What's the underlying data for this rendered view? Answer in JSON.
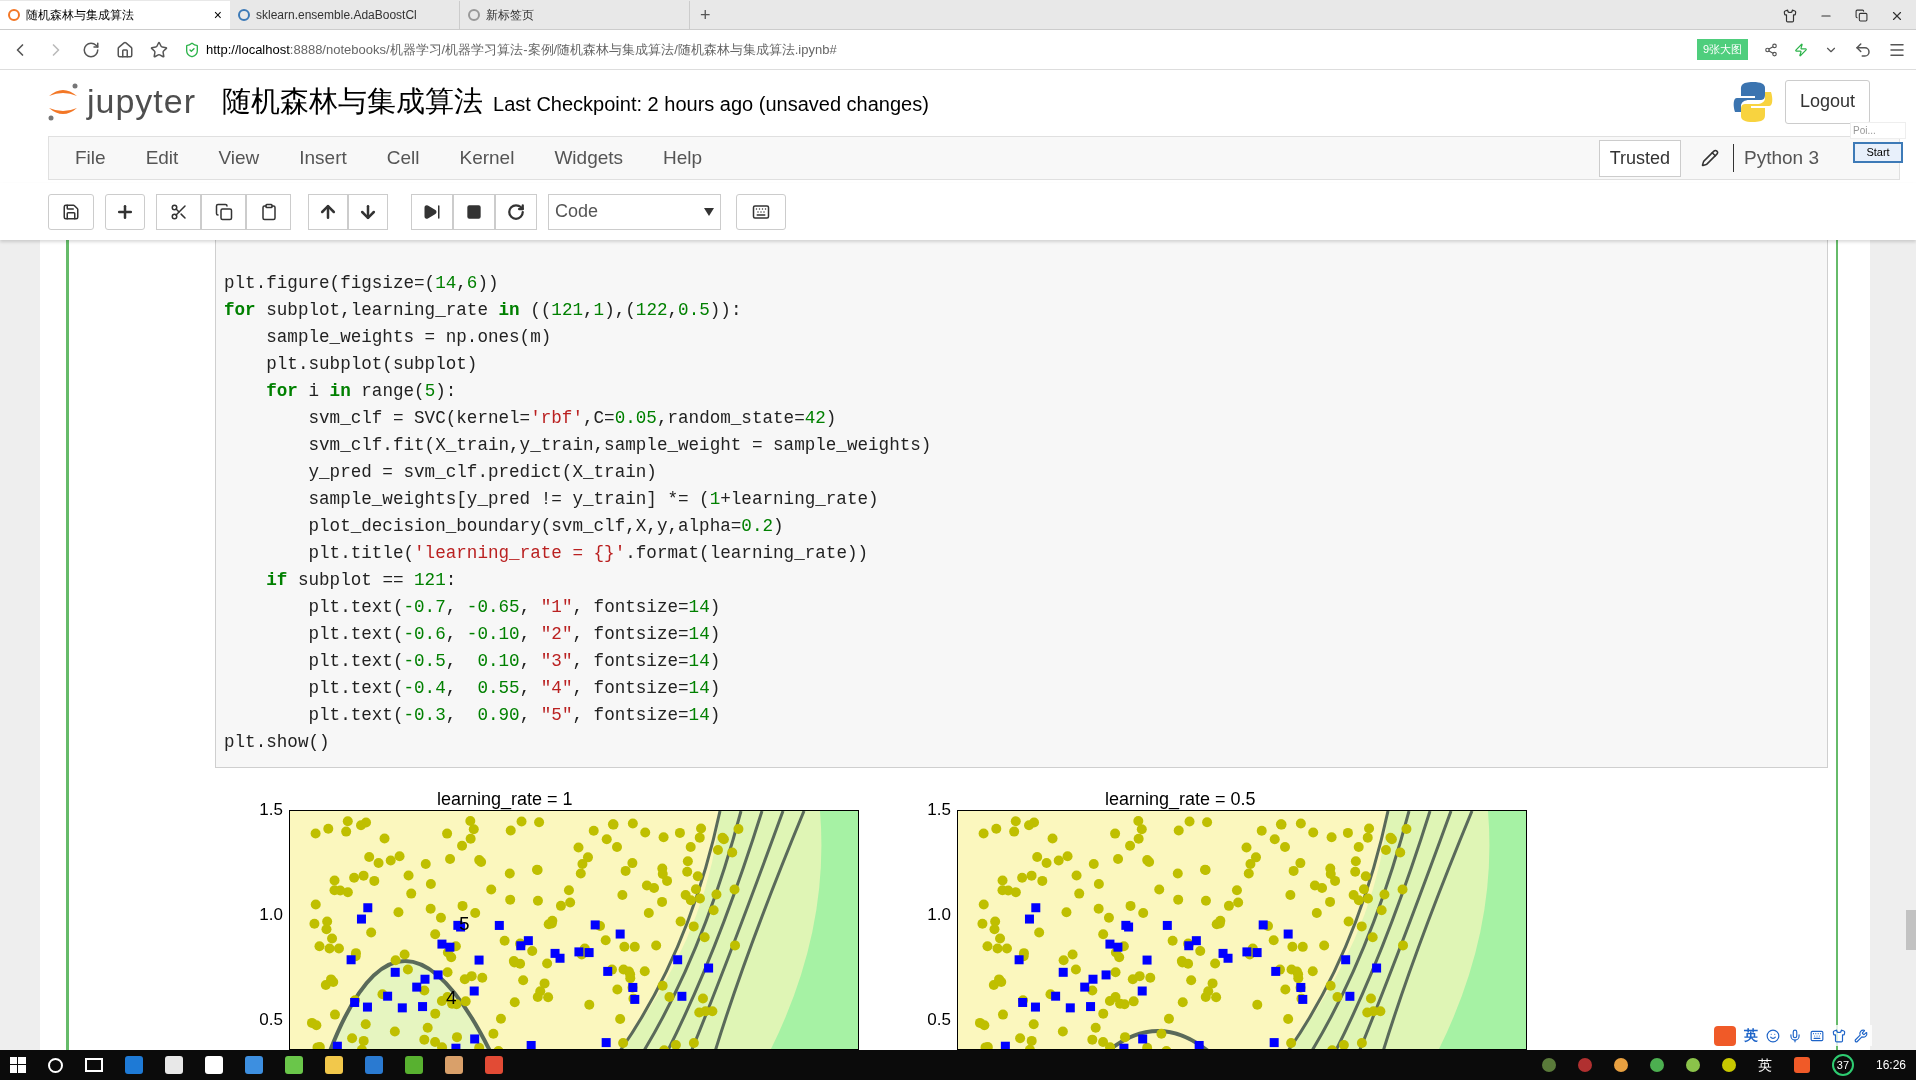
{
  "browser": {
    "tabs": [
      {
        "label": "随机森林与集成算法",
        "selected": true,
        "close": "×"
      },
      {
        "label": "sklearn.ensemble.AdaBoostCl",
        "selected": false
      },
      {
        "label": "新标签页",
        "selected": false
      }
    ],
    "new_tab": "+",
    "url_host": "http://localhost",
    "url_rest": ":8888/notebooks/机器学习/机器学习算法-案例/随机森林与集成算法/随机森林与集成算法.ipynb#",
    "badge": "9张大图"
  },
  "header": {
    "logo_text": "jupyter",
    "title": "随机森林与集成算法",
    "checkpoint": "Last Checkpoint: 2 hours ago (unsaved changes)",
    "logout": "Logout",
    "popup_label": "Poi...",
    "popup_button": "Start"
  },
  "menu": {
    "items": [
      "File",
      "Edit",
      "View",
      "Insert",
      "Cell",
      "Kernel",
      "Widgets",
      "Help"
    ],
    "trusted": "Trusted",
    "kernel": "Python 3"
  },
  "toolbar": {
    "cell_type": "Code"
  },
  "code": [
    [
      {
        "kind": "p",
        "text": "plt.figure(figsize=("
      },
      {
        "kind": "n",
        "text": "14"
      },
      {
        "kind": "p",
        "text": ","
      },
      {
        "kind": "n",
        "text": "6"
      },
      {
        "kind": "p",
        "text": "))"
      }
    ],
    [
      {
        "kind": "k",
        "text": "for"
      },
      {
        "kind": "p",
        "text": " subplot,learning_rate "
      },
      {
        "kind": "k",
        "text": "in"
      },
      {
        "kind": "p",
        "text": " (("
      },
      {
        "kind": "n",
        "text": "121"
      },
      {
        "kind": "p",
        "text": ","
      },
      {
        "kind": "n",
        "text": "1"
      },
      {
        "kind": "p",
        "text": "),("
      },
      {
        "kind": "n",
        "text": "122"
      },
      {
        "kind": "p",
        "text": ","
      },
      {
        "kind": "n",
        "text": "0.5"
      },
      {
        "kind": "p",
        "text": ")):"
      }
    ],
    [
      {
        "kind": "p",
        "text": "    sample_weights = np.ones(m)"
      }
    ],
    [
      {
        "kind": "p",
        "text": "    plt.subplot(subplot)"
      }
    ],
    [
      {
        "kind": "k",
        "text": "    for"
      },
      {
        "kind": "p",
        "text": " i "
      },
      {
        "kind": "k",
        "text": "in"
      },
      {
        "kind": "p",
        "text": " range("
      },
      {
        "kind": "n",
        "text": "5"
      },
      {
        "kind": "p",
        "text": "):"
      }
    ],
    [
      {
        "kind": "p",
        "text": "        svm_clf = SVC(kernel="
      },
      {
        "kind": "s",
        "text": "'rbf'"
      },
      {
        "kind": "p",
        "text": ",C="
      },
      {
        "kind": "n",
        "text": "0.05"
      },
      {
        "kind": "p",
        "text": ",random_state="
      },
      {
        "kind": "n",
        "text": "42"
      },
      {
        "kind": "p",
        "text": ")"
      }
    ],
    [
      {
        "kind": "p",
        "text": "        svm_clf.fit(X_train,y_train,sample_weight = sample_weights)"
      }
    ],
    [
      {
        "kind": "p",
        "text": "        y_pred = svm_clf.predict(X_train)"
      }
    ],
    [
      {
        "kind": "p",
        "text": "        sample_weights[y_pred != y_train] *= ("
      },
      {
        "kind": "n",
        "text": "1"
      },
      {
        "kind": "p",
        "text": "+learning_rate)"
      }
    ],
    [
      {
        "kind": "p",
        "text": "        plot_decision_boundary(svm_clf,X,y,alpha="
      },
      {
        "kind": "n",
        "text": "0.2"
      },
      {
        "kind": "p",
        "text": ")"
      }
    ],
    [
      {
        "kind": "p",
        "text": "        plt.title("
      },
      {
        "kind": "s",
        "text": "'learning_rate = {}'"
      },
      {
        "kind": "p",
        "text": ".format(learning_rate))"
      }
    ],
    [
      {
        "kind": "k",
        "text": "    if"
      },
      {
        "kind": "p",
        "text": " subplot == "
      },
      {
        "kind": "n",
        "text": "121"
      },
      {
        "kind": "p",
        "text": ":"
      }
    ],
    [
      {
        "kind": "p",
        "text": "        plt.text("
      },
      {
        "kind": "n",
        "text": "-0.7"
      },
      {
        "kind": "p",
        "text": ", "
      },
      {
        "kind": "n",
        "text": "-0.65"
      },
      {
        "kind": "p",
        "text": ", "
      },
      {
        "kind": "s",
        "text": "\"1\""
      },
      {
        "kind": "p",
        "text": ", fontsize="
      },
      {
        "kind": "n",
        "text": "14"
      },
      {
        "kind": "p",
        "text": ")"
      }
    ],
    [
      {
        "kind": "p",
        "text": "        plt.text("
      },
      {
        "kind": "n",
        "text": "-0.6"
      },
      {
        "kind": "p",
        "text": ", "
      },
      {
        "kind": "n",
        "text": "-0.10"
      },
      {
        "kind": "p",
        "text": ", "
      },
      {
        "kind": "s",
        "text": "\"2\""
      },
      {
        "kind": "p",
        "text": ", fontsize="
      },
      {
        "kind": "n",
        "text": "14"
      },
      {
        "kind": "p",
        "text": ")"
      }
    ],
    [
      {
        "kind": "p",
        "text": "        plt.text("
      },
      {
        "kind": "n",
        "text": "-0.5"
      },
      {
        "kind": "p",
        "text": ",  "
      },
      {
        "kind": "n",
        "text": "0.10"
      },
      {
        "kind": "p",
        "text": ", "
      },
      {
        "kind": "s",
        "text": "\"3\""
      },
      {
        "kind": "p",
        "text": ", fontsize="
      },
      {
        "kind": "n",
        "text": "14"
      },
      {
        "kind": "p",
        "text": ")"
      }
    ],
    [
      {
        "kind": "p",
        "text": "        plt.text("
      },
      {
        "kind": "n",
        "text": "-0.4"
      },
      {
        "kind": "p",
        "text": ",  "
      },
      {
        "kind": "n",
        "text": "0.55"
      },
      {
        "kind": "p",
        "text": ", "
      },
      {
        "kind": "s",
        "text": "\"4\""
      },
      {
        "kind": "p",
        "text": ", fontsize="
      },
      {
        "kind": "n",
        "text": "14"
      },
      {
        "kind": "p",
        "text": ")"
      }
    ],
    [
      {
        "kind": "p",
        "text": "        plt.text("
      },
      {
        "kind": "n",
        "text": "-0.3"
      },
      {
        "kind": "p",
        "text": ",  "
      },
      {
        "kind": "n",
        "text": "0.90"
      },
      {
        "kind": "p",
        "text": ", "
      },
      {
        "kind": "s",
        "text": "\"5\""
      },
      {
        "kind": "p",
        "text": ", fontsize="
      },
      {
        "kind": "n",
        "text": "14"
      },
      {
        "kind": "p",
        "text": ")"
      }
    ],
    [
      {
        "kind": "p",
        "text": "plt.show()"
      }
    ]
  ],
  "plots": [
    {
      "title": "learning_rate = 1",
      "yticks": [
        "1.5",
        "1.0",
        "0.5"
      ],
      "annotations": [
        "5",
        "4"
      ]
    },
    {
      "title": "learning_rate = 0.5",
      "yticks": [
        "1.5",
        "1.0",
        "0.5"
      ]
    }
  ],
  "ime": {
    "lang": "英"
  },
  "taskbar": {
    "lang": "英",
    "badge": "37",
    "time": "16:26"
  }
}
